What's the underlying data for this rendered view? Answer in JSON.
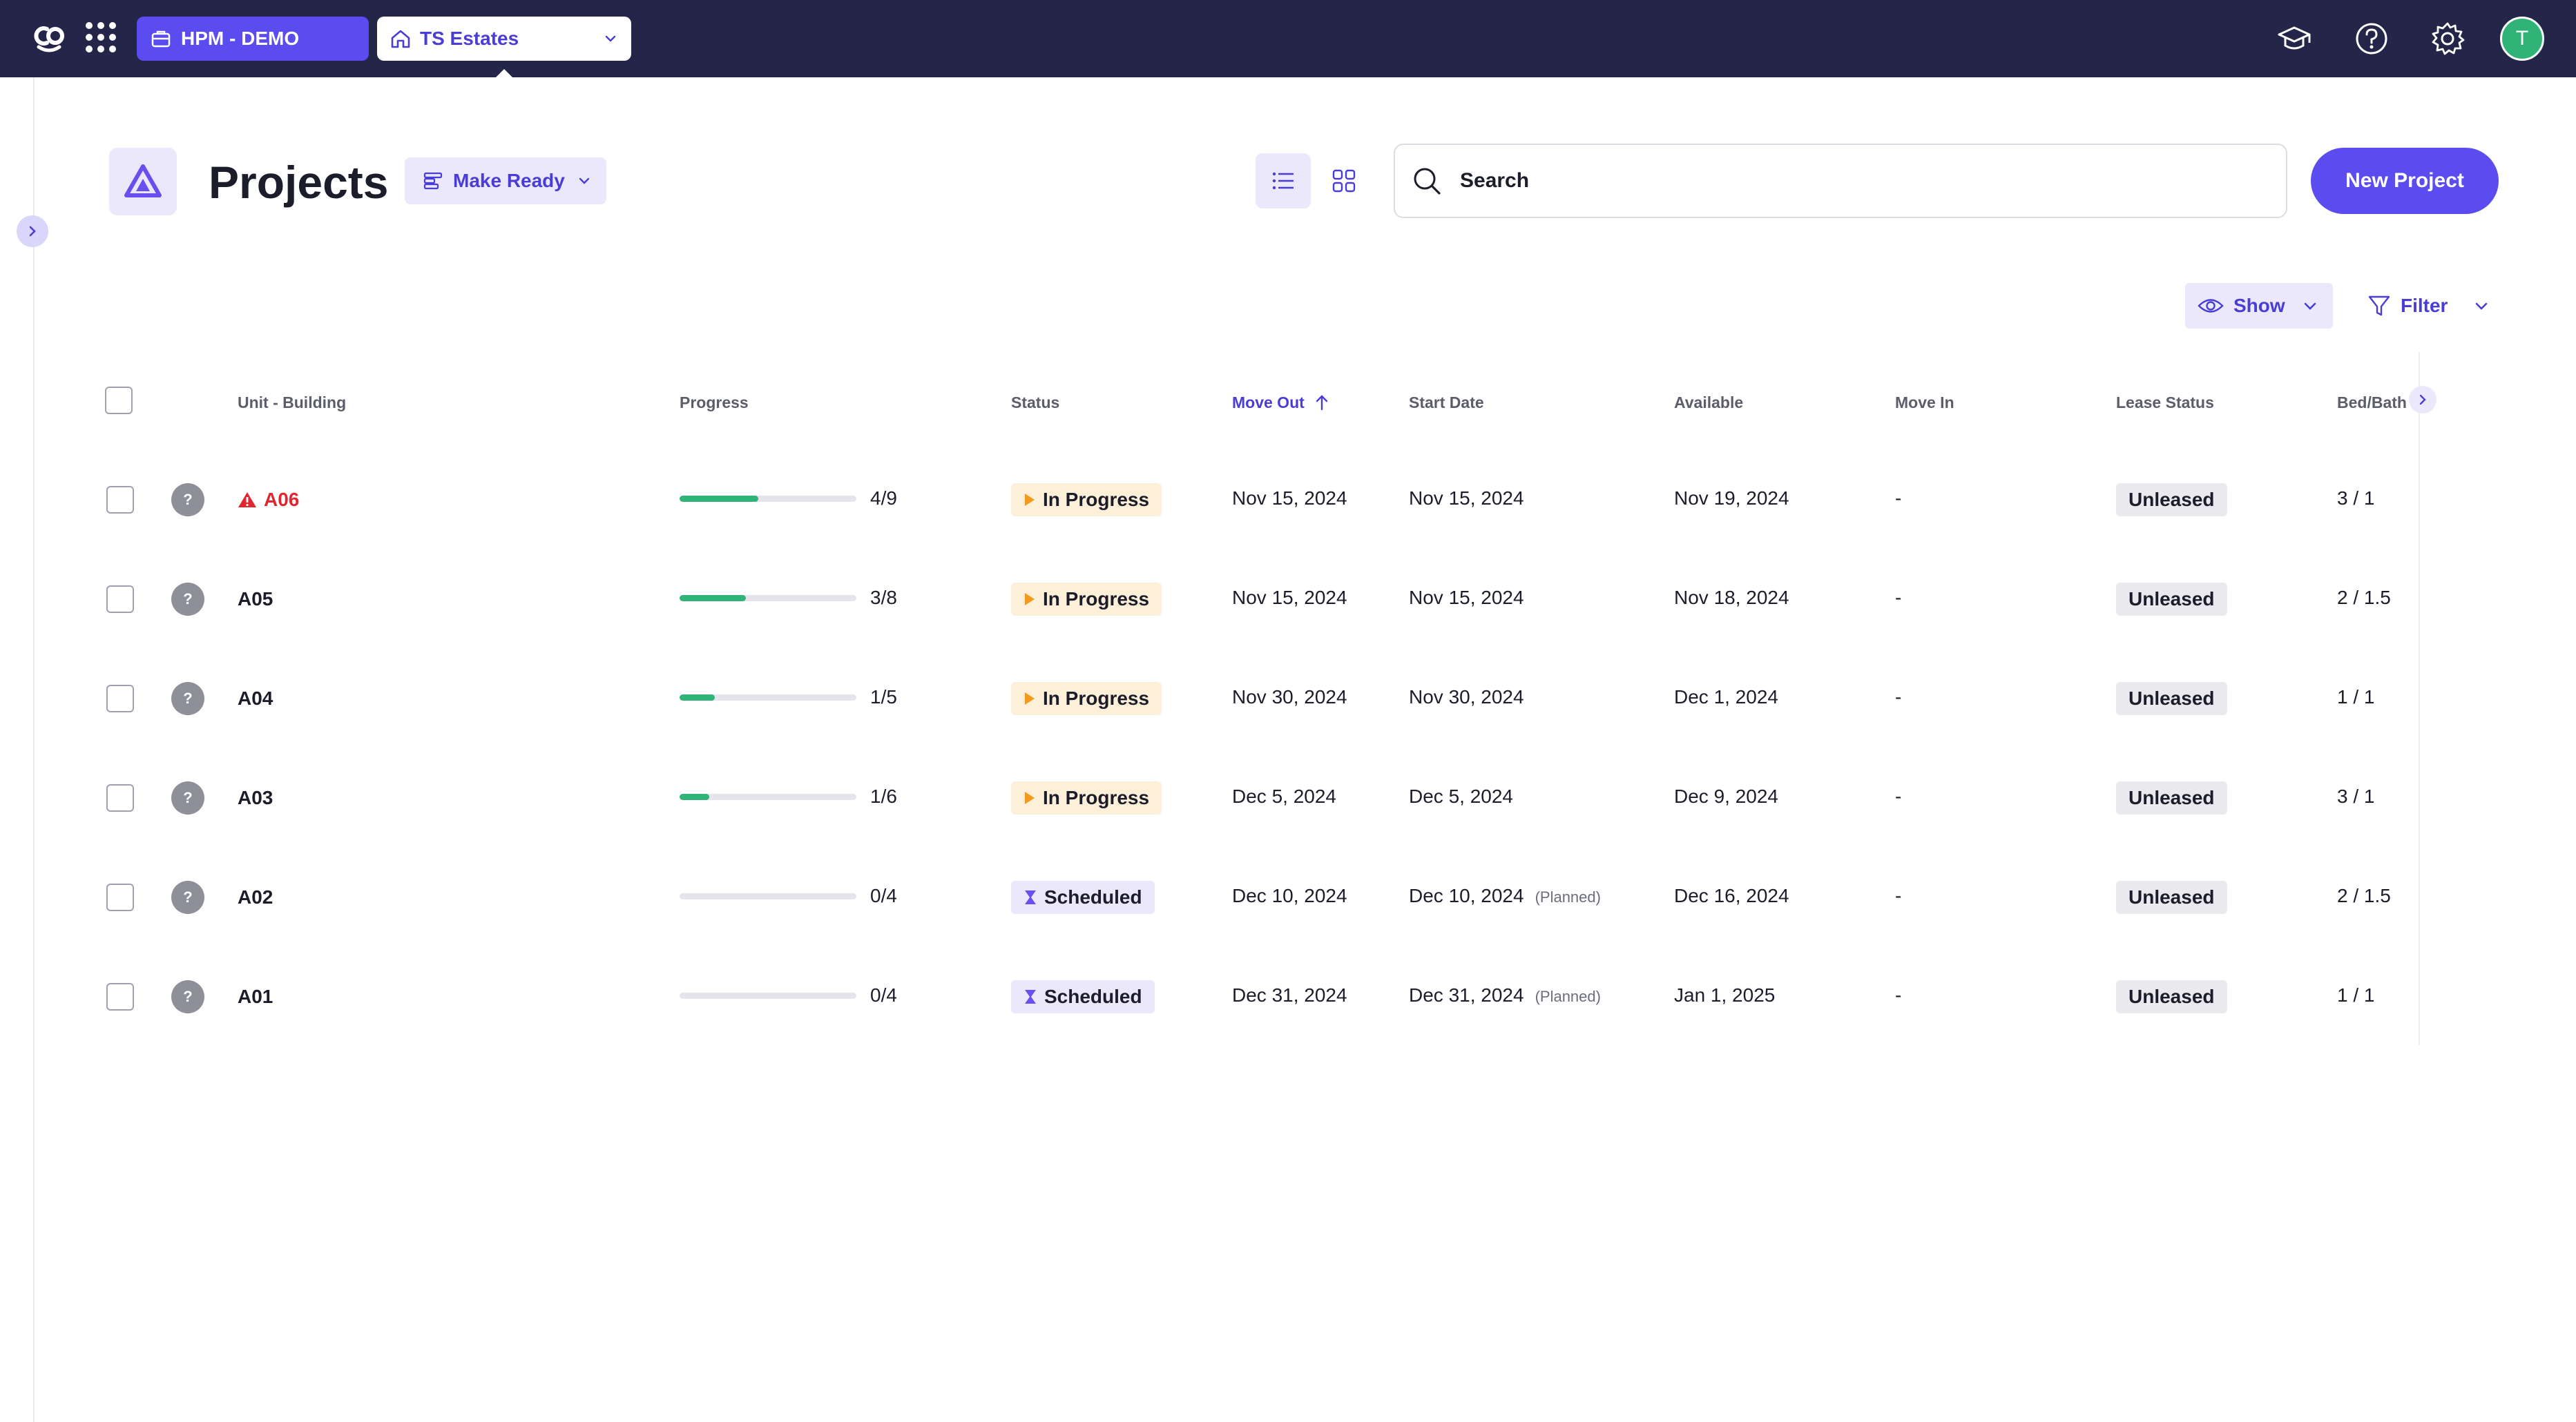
{
  "topbar": {
    "org_label": "HPM - DEMO",
    "property_label": "TS Estates",
    "avatar_initial": "T",
    "icons": [
      "logo-icon",
      "apps-grid-icon",
      "briefcase-icon",
      "house-icon",
      "chevron-down-icon",
      "graduation-cap-icon",
      "help-icon",
      "gear-icon"
    ]
  },
  "header": {
    "title": "Projects",
    "workflow_label": "Make Ready",
    "search_placeholder": "Search",
    "new_button": "New Project",
    "show_label": "Show",
    "filter_label": "Filter"
  },
  "table": {
    "columns": [
      "Unit - Building",
      "Progress",
      "Status",
      "Move Out",
      "Start Date",
      "Available",
      "Move In",
      "Lease Status",
      "Bed/Bath"
    ],
    "sorted_column": "Move Out",
    "sort_direction": "ascending",
    "rows": [
      {
        "unit": "A06",
        "alert": true,
        "progress_done": 4,
        "progress_total": 9,
        "progress_label": "4/9",
        "status": "In Progress",
        "status_type": "inprog",
        "move_out": "Nov 15, 2024",
        "start_date": "Nov 15, 2024",
        "start_note": "",
        "available": "Nov 19, 2024",
        "move_in": "-",
        "lease": "Unleased",
        "bedbath": "3 / 1"
      },
      {
        "unit": "A05",
        "alert": false,
        "progress_done": 3,
        "progress_total": 8,
        "progress_label": "3/8",
        "status": "In Progress",
        "status_type": "inprog",
        "move_out": "Nov 15, 2024",
        "start_date": "Nov 15, 2024",
        "start_note": "",
        "available": "Nov 18, 2024",
        "move_in": "-",
        "lease": "Unleased",
        "bedbath": "2 / 1.5"
      },
      {
        "unit": "A04",
        "alert": false,
        "progress_done": 1,
        "progress_total": 5,
        "progress_label": "1/5",
        "status": "In Progress",
        "status_type": "inprog",
        "move_out": "Nov 30, 2024",
        "start_date": "Nov 30, 2024",
        "start_note": "",
        "available": "Dec 1, 2024",
        "move_in": "-",
        "lease": "Unleased",
        "bedbath": "1 / 1"
      },
      {
        "unit": "A03",
        "alert": false,
        "progress_done": 1,
        "progress_total": 6,
        "progress_label": "1/6",
        "status": "In Progress",
        "status_type": "inprog",
        "move_out": "Dec 5, 2024",
        "start_date": "Dec 5, 2024",
        "start_note": "",
        "available": "Dec 9, 2024",
        "move_in": "-",
        "lease": "Unleased",
        "bedbath": "3 / 1"
      },
      {
        "unit": "A02",
        "alert": false,
        "progress_done": 0,
        "progress_total": 4,
        "progress_label": "0/4",
        "status": "Scheduled",
        "status_type": "sched",
        "move_out": "Dec 10, 2024",
        "start_date": "Dec 10, 2024",
        "start_note": "(Planned)",
        "available": "Dec 16, 2024",
        "move_in": "-",
        "lease": "Unleased",
        "bedbath": "2 / 1.5"
      },
      {
        "unit": "A01",
        "alert": false,
        "progress_done": 0,
        "progress_total": 4,
        "progress_label": "0/4",
        "status": "Scheduled",
        "status_type": "sched",
        "move_out": "Dec 31, 2024",
        "start_date": "Dec 31, 2024",
        "start_note": "(Planned)",
        "available": "Jan 1, 2025",
        "move_in": "-",
        "lease": "Unleased",
        "bedbath": "1 / 1"
      }
    ]
  },
  "colors": {
    "topbar": "#232549",
    "accent": "#5b4cf0",
    "progress": "#2fb377",
    "alert": "#e0262f",
    "in_progress_bg": "#fdf0d8",
    "in_progress_icon": "#f29a1f",
    "scheduled_icon": "#6a4ef0"
  }
}
